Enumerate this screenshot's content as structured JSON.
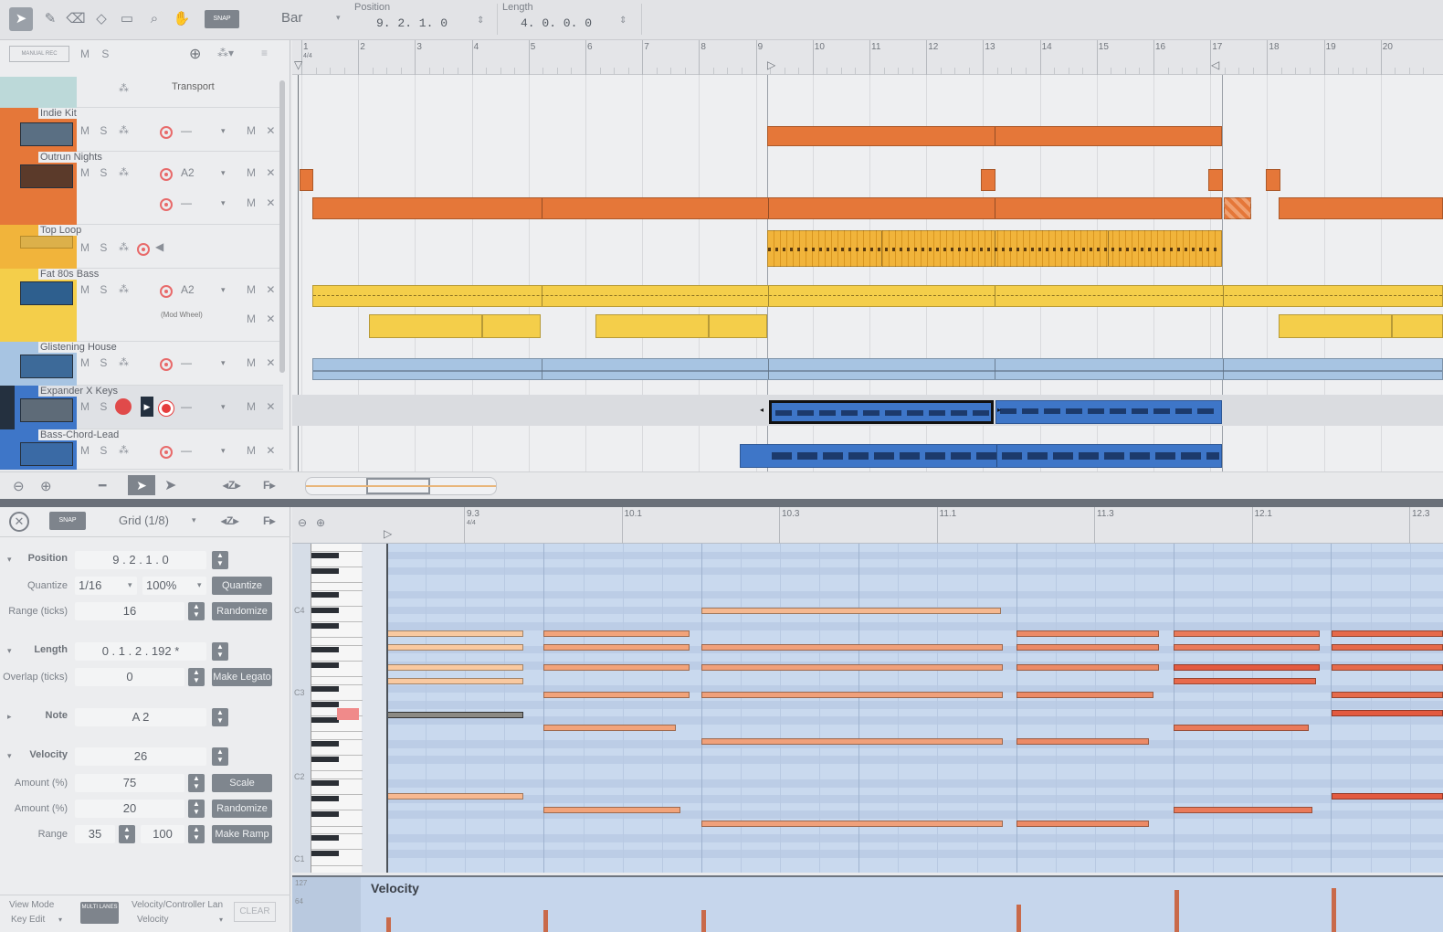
{
  "toolbar": {
    "tools": [
      "arrow-tool",
      "pencil-tool",
      "eraser-tool",
      "paint-tool",
      "comment-tool",
      "zoom-tool",
      "hand-tool"
    ],
    "snap_label": "SNAP",
    "timebase": "Bar",
    "position_label": "Position",
    "position_value": "9. 2. 1. 0",
    "length_label": "Length",
    "length_value": "4. 0. 0. 0"
  },
  "track_header": {
    "manual_rec": "MANUAL REC",
    "ms": "M S",
    "transport": "Transport"
  },
  "ruler_bars": [
    "1",
    "2",
    "3",
    "4",
    "5",
    "6",
    "7",
    "8",
    "9",
    "10",
    "11",
    "12",
    "13",
    "14",
    "15",
    "16",
    "17",
    "18",
    "19",
    "20"
  ],
  "ruler_sub": "4/4",
  "tracks": [
    {
      "name": "Indie Kit",
      "color": "#e57739",
      "msr": "M S",
      "input": "—",
      "mx": "M ✕"
    },
    {
      "name": "Outrun Nights",
      "color": "#e57739",
      "msr": "M S",
      "input": "A2",
      "input2": "—",
      "mx": "M ✕"
    },
    {
      "name": "Top Loop",
      "color": "#f1b43b",
      "msr": "M S"
    },
    {
      "name": "Fat 80s Bass",
      "color": "#f4ce4a",
      "msr": "M S",
      "input": "A2",
      "sub": "(Mod Wheel)",
      "mx": "M ✕"
    },
    {
      "name": "Glistening House",
      "color": "#a7c4e2",
      "msr": "M S",
      "input": "—",
      "mx": "M ✕"
    },
    {
      "name": "Expander X Keys",
      "color": "#3e76c8",
      "msr": "M S",
      "input": "—",
      "mx": "M ✕"
    },
    {
      "name": "Bass-Chord-Lead",
      "color": "#3e76c8",
      "msr": "M S",
      "input": "—",
      "mx": "M ✕"
    }
  ],
  "editor": {
    "snap_label": "SNAP",
    "grid": "Grid (1/8)",
    "position_label": "Position",
    "position_value": "9 . 2 . 1 . 0",
    "quantize_label": "Quantize",
    "quantize_value": "1/16",
    "quantize_pct": "100%",
    "quantize_btn": "Quantize",
    "range_label": "Range (ticks)",
    "range_value": "16",
    "randomize_btn": "Randomize",
    "length_label": "Length",
    "length_value": "0 . 1 . 2 . 192 *",
    "overlap_label": "Overlap (ticks)",
    "overlap_value": "0",
    "legato_btn": "Make Legato",
    "note_label": "Note",
    "note_value": "A 2",
    "velocity_label": "Velocity",
    "velocity_value": "26",
    "amount1_label": "Amount (%)",
    "amount1_value": "75",
    "scale_btn": "Scale",
    "amount2_label": "Amount (%)",
    "amount2_value": "20",
    "randomize2_btn": "Randomize",
    "vrange_label": "Range",
    "vrange_min": "35",
    "vrange_max": "100",
    "ramp_btn": "Make Ramp",
    "view_mode_label": "View Mode",
    "view_mode_value": "Key Edit",
    "multi_lanes": "MULTI LANES",
    "vcl_label": "Velocity/Controller Lan",
    "vcl_value": "Velocity",
    "clear_btn": "CLEAR"
  },
  "piano_ruler": [
    "9.3",
    "10.1",
    "10.3",
    "11.1",
    "11.3",
    "12.1",
    "12.3"
  ],
  "piano_ruler_sub": "4/4",
  "key_labels": [
    "C4",
    "C3",
    "C2",
    "C1"
  ],
  "velocity_lane_label": "Velocity",
  "velocity_scale": [
    "127",
    "64"
  ]
}
